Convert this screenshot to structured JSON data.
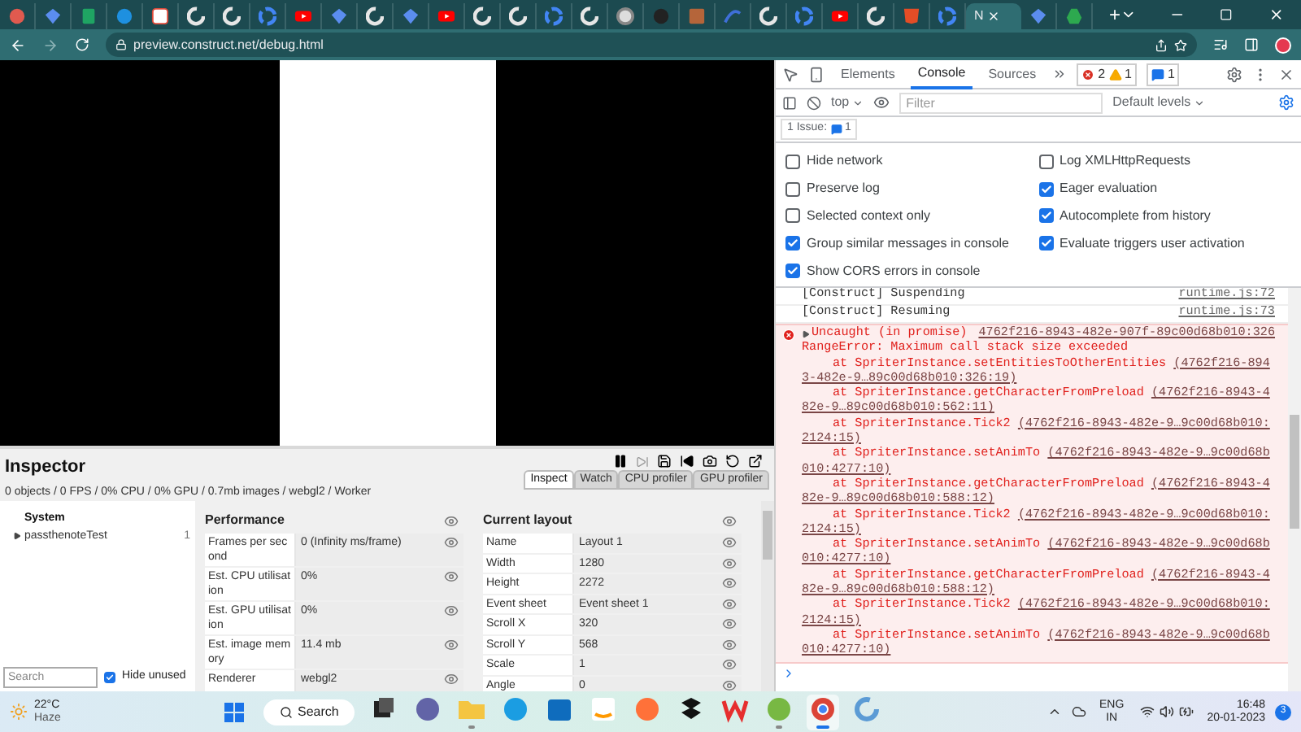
{
  "browser": {
    "tabs": [
      {
        "kind": "red",
        "selected": false
      },
      {
        "kind": "gem",
        "selected": false
      },
      {
        "kind": "sheet",
        "selected": false
      },
      {
        "kind": "skype",
        "selected": false
      },
      {
        "kind": "calendar",
        "selected": false
      },
      {
        "kind": "construct",
        "selected": false
      },
      {
        "kind": "construct",
        "selected": false
      },
      {
        "kind": "google",
        "selected": false
      },
      {
        "kind": "youtube",
        "selected": false
      },
      {
        "kind": "gem",
        "selected": false
      },
      {
        "kind": "construct",
        "selected": false
      },
      {
        "kind": "gem",
        "selected": false
      },
      {
        "kind": "youtube",
        "selected": false
      },
      {
        "kind": "construct",
        "selected": false
      },
      {
        "kind": "construct",
        "selected": false
      },
      {
        "kind": "google",
        "selected": false
      },
      {
        "kind": "construct",
        "selected": false
      },
      {
        "kind": "chrome",
        "selected": false
      },
      {
        "kind": "github",
        "selected": false
      },
      {
        "kind": "image",
        "selected": false
      },
      {
        "kind": "wave",
        "selected": false
      },
      {
        "kind": "construct",
        "selected": false
      },
      {
        "kind": "google",
        "selected": false
      },
      {
        "kind": "youtube",
        "selected": false
      },
      {
        "kind": "construct",
        "selected": false
      },
      {
        "kind": "html5",
        "selected": false
      },
      {
        "kind": "google",
        "selected": false
      },
      {
        "kind": "text",
        "title": "N",
        "selected": true
      },
      {
        "kind": "gem",
        "selected": false
      },
      {
        "kind": "drive",
        "selected": false
      }
    ],
    "new_tab": "+",
    "url": "preview.construct.net/debug.html"
  },
  "inspector": {
    "title": "Inspector",
    "stats": "0 objects / 0 FPS / 0% CPU / 0% GPU / 0.7mb images / webgl2 / Worker",
    "tabs": [
      {
        "label": "Inspect",
        "selected": true
      },
      {
        "label": "Watch",
        "selected": false
      },
      {
        "label": "CPU profiler",
        "selected": false
      },
      {
        "label": "GPU profiler",
        "selected": false
      }
    ],
    "tree": {
      "heading": "System",
      "items": [
        {
          "label": "passthenoteTest",
          "count": "1",
          "expanded": false
        }
      ]
    },
    "search": {
      "placeholder": "Search"
    },
    "hide_unused": {
      "label": "Hide unused",
      "checked": true
    },
    "sections": [
      {
        "title": "Performance",
        "rows": [
          {
            "label": "Frames per second",
            "value": "0 (Infinity ms/frame)"
          },
          {
            "label": "Est. CPU utilisation",
            "value": "0%"
          },
          {
            "label": "Est. GPU utilisation",
            "value": "0%"
          },
          {
            "label": "Est. image memory",
            "value": "11.4 mb"
          },
          {
            "label": "Renderer",
            "value": "webgl2"
          }
        ]
      },
      {
        "title": "Current layout",
        "rows": [
          {
            "label": "Name",
            "value": "Layout 1"
          },
          {
            "label": "Width",
            "value": "1280"
          },
          {
            "label": "Height",
            "value": "2272"
          },
          {
            "label": "Event sheet",
            "value": "Event sheet 1"
          },
          {
            "label": "Scroll X",
            "value": "320"
          },
          {
            "label": "Scroll Y",
            "value": "568"
          },
          {
            "label": "Scale",
            "value": "1"
          },
          {
            "label": "Angle",
            "value": "0"
          }
        ]
      }
    ]
  },
  "devtools": {
    "tabs": [
      {
        "label": "Elements",
        "selected": false
      },
      {
        "label": "Console",
        "selected": true
      },
      {
        "label": "Sources",
        "selected": false
      }
    ],
    "errors": "2",
    "warnings": "1",
    "infos": "1",
    "context": "top",
    "filter": {
      "placeholder": "Filter"
    },
    "levels": "Default levels",
    "issues": {
      "label": "1 Issue:",
      "count": "1"
    },
    "settings_left": [
      {
        "label": "Hide network",
        "checked": false
      },
      {
        "label": "Preserve log",
        "checked": false
      },
      {
        "label": "Selected context only",
        "checked": false
      },
      {
        "label": "Group similar messages in console",
        "checked": true
      },
      {
        "label": "Show CORS errors in console",
        "checked": true
      }
    ],
    "settings_right": [
      {
        "label": "Log XMLHttpRequests",
        "checked": false
      },
      {
        "label": "Eager evaluation",
        "checked": true
      },
      {
        "label": "Autocomplete from history",
        "checked": true
      },
      {
        "label": "Evaluate triggers user activation",
        "checked": true
      }
    ],
    "messages": [
      {
        "kind": "log",
        "text": "[Construct] Suspending",
        "source": "runtime.js:72"
      },
      {
        "kind": "log",
        "text": "[Construct] Resuming",
        "source": "runtime.js:73"
      },
      {
        "kind": "error",
        "summary": "Uncaught (in promise)",
        "link": "4762f216-8943-482e-907f-89c00d68b010:326",
        "text": "RangeError: Maximum call stack size exceeded",
        "stack": [
          {
            "call": "at SpriterInstance.setEntitiesToOtherEntities",
            "link": "(4762f216-8943-482e-9…89c00d68b010:326:19)"
          },
          {
            "call": "at SpriterInstance.getCharacterFromPreload",
            "link": "(4762f216-8943-482e-9…89c00d68b010:562:11)"
          },
          {
            "call": "at SpriterInstance.Tick2",
            "link": "(4762f216-8943-482e-9…9c00d68b010:2124:15)"
          },
          {
            "call": "at SpriterInstance.setAnimTo",
            "link": "(4762f216-8943-482e-9…9c00d68b010:4277:10)"
          },
          {
            "call": "at SpriterInstance.getCharacterFromPreload",
            "link": "(4762f216-8943-482e-9…89c00d68b010:588:12)"
          },
          {
            "call": "at SpriterInstance.Tick2",
            "link": "(4762f216-8943-482e-9…9c00d68b010:2124:15)"
          },
          {
            "call": "at SpriterInstance.setAnimTo",
            "link": "(4762f216-8943-482e-9…9c00d68b010:4277:10)"
          },
          {
            "call": "at SpriterInstance.getCharacterFromPreload",
            "link": "(4762f216-8943-482e-9…89c00d68b010:588:12)"
          },
          {
            "call": "at SpriterInstance.Tick2",
            "link": "(4762f216-8943-482e-9…9c00d68b010:2124:15)"
          },
          {
            "call": "at SpriterInstance.setAnimTo",
            "link": "(4762f216-8943-482e-9…9c00d68b010:4277:10)"
          }
        ]
      }
    ]
  },
  "taskbar": {
    "temperature": "22°C",
    "condition": "Haze",
    "search": "Search",
    "apps": [
      {
        "kind": "taskview",
        "running": false,
        "selected": false
      },
      {
        "kind": "chat",
        "running": false,
        "selected": false
      },
      {
        "kind": "folder",
        "running": true,
        "selected": false
      },
      {
        "kind": "edge",
        "running": false,
        "selected": false
      },
      {
        "kind": "store",
        "running": false,
        "selected": false
      },
      {
        "kind": "amazon",
        "running": false,
        "selected": false
      },
      {
        "kind": "firefox",
        "running": false,
        "selected": false
      },
      {
        "kind": "dropbox",
        "running": false,
        "selected": false
      },
      {
        "kind": "wps",
        "running": false,
        "selected": false
      },
      {
        "kind": "torrent",
        "running": true,
        "selected": false
      },
      {
        "kind": "chrome",
        "running": true,
        "selected": true
      },
      {
        "kind": "construct",
        "running": false,
        "selected": false
      }
    ],
    "language": "ENG",
    "region": "IN",
    "time": "16:48",
    "date": "20-01-2023",
    "notifications": "3"
  }
}
